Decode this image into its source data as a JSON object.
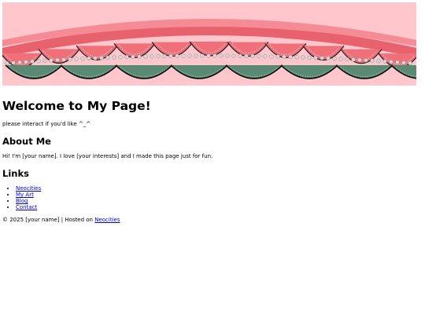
{
  "page": {
    "title": "Welcome to My Page!",
    "tagline": "please interact if you'd like ^_^"
  },
  "about": {
    "heading": "About Me",
    "text": "Hi! I'm [your name]. I love [your interests] and I made this page just for fun."
  },
  "links": {
    "heading": "Links",
    "items": [
      {
        "label": "Neocities"
      },
      {
        "label": "My Art"
      },
      {
        "label": "Blog"
      },
      {
        "label": "Contact"
      }
    ]
  },
  "footer": {
    "prefix": "© 2025 [your name] | Hosted on ",
    "link_label": "Neocities"
  },
  "colors": {
    "banner_bg": "#ffc7cc",
    "lace_pink": "#f0707a",
    "lace_green": "#5a8a74",
    "link": "#0000ee"
  }
}
